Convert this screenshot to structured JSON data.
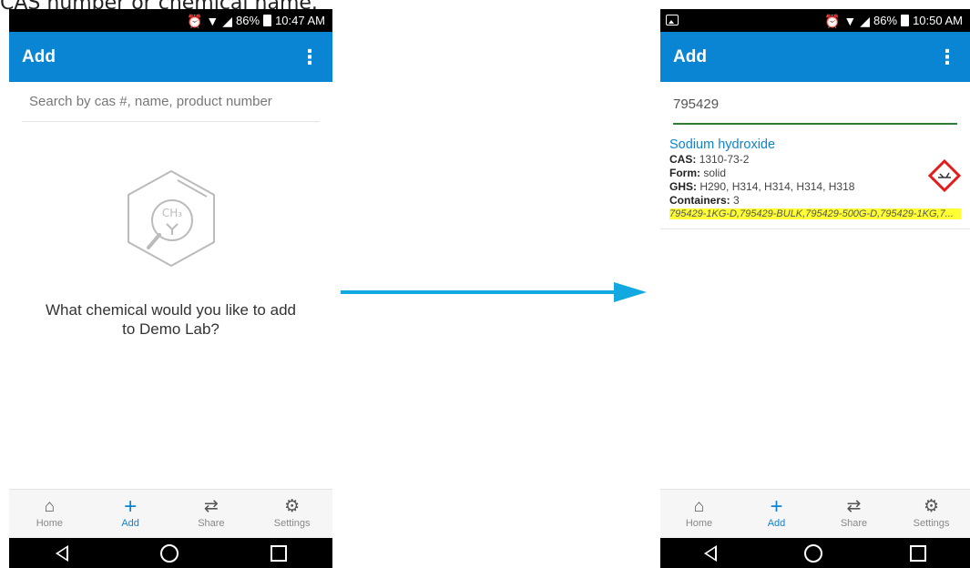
{
  "caption": "CAS number or chemical name.",
  "left": {
    "status": {
      "battery": "86%",
      "time": "10:47 AM"
    },
    "appbar": {
      "title": "Add",
      "menu_icon": "more-vert-icon"
    },
    "search": {
      "placeholder": "Search by cas #, name, product number"
    },
    "empty": {
      "message": "What chemical would you like to add to Demo Lab?"
    },
    "nav": [
      {
        "label": "Home",
        "icon": "home-icon"
      },
      {
        "label": "Add",
        "icon": "plus-icon"
      },
      {
        "label": "Share",
        "icon": "swap-icon"
      },
      {
        "label": "Settings",
        "icon": "gear-icon"
      }
    ]
  },
  "right": {
    "status": {
      "battery": "86%",
      "time": "10:50 AM"
    },
    "appbar": {
      "title": "Add",
      "menu_icon": "more-vert-icon"
    },
    "search": {
      "value": "795429"
    },
    "result": {
      "name": "Sodium hydroxide",
      "cas_label": "CAS:",
      "cas": "1310-73-2",
      "form_label": "Form:",
      "form": "solid",
      "ghs_label": "GHS:",
      "ghs": "H290, H314, H314, H314, H318",
      "containers_label": "Containers:",
      "containers": "3",
      "products": "795429-1KG-D,795429-BULK,795429-500G-D,795429-1KG,7..."
    },
    "nav": [
      {
        "label": "Home",
        "icon": "home-icon"
      },
      {
        "label": "Add",
        "icon": "plus-icon"
      },
      {
        "label": "Share",
        "icon": "swap-icon"
      },
      {
        "label": "Settings",
        "icon": "gear-icon"
      }
    ]
  },
  "colors": {
    "appbar": "#0a85d4",
    "accent": "#0a85d4",
    "arrow": "#12a8e0",
    "highlight": "#ffff33",
    "search_active": "#2e7d32"
  }
}
